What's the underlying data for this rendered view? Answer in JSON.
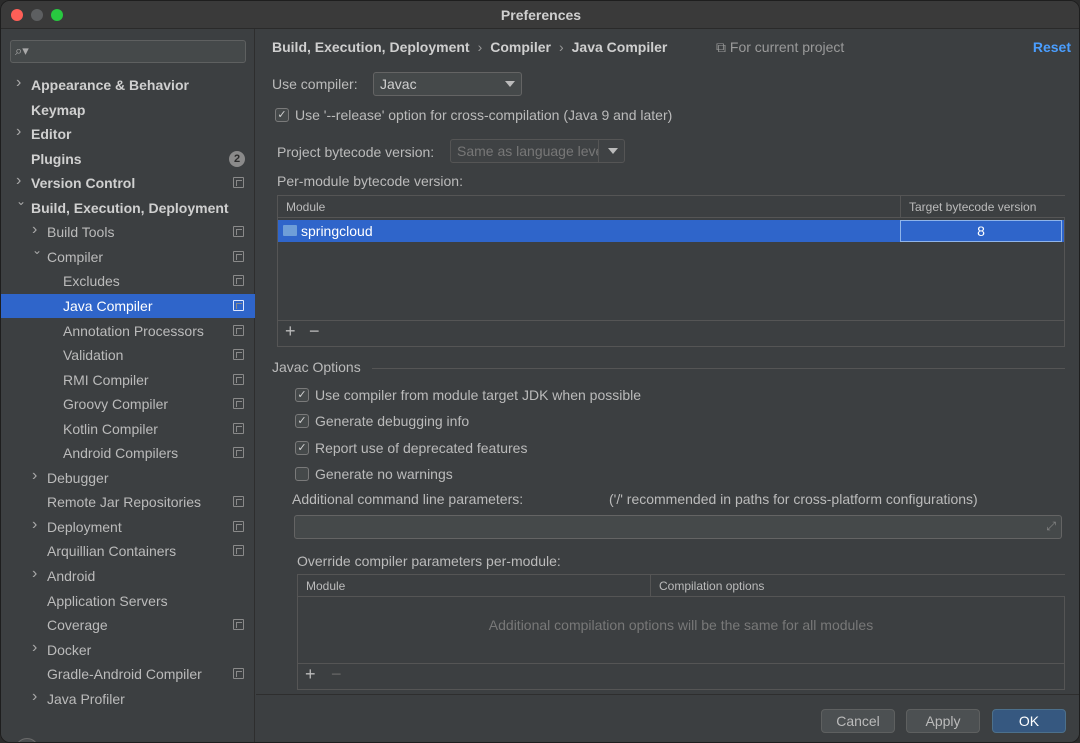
{
  "window": {
    "title": "Preferences"
  },
  "search": {
    "placeholder": ""
  },
  "sidebar": {
    "items": [
      {
        "label": "Appearance & Behavior",
        "level": 0,
        "arrow": "right",
        "bold": true
      },
      {
        "label": "Keymap",
        "level": 0,
        "arrow": "",
        "bold": true
      },
      {
        "label": "Editor",
        "level": 0,
        "arrow": "right",
        "bold": true
      },
      {
        "label": "Plugins",
        "level": 0,
        "arrow": "",
        "bold": true,
        "badge": "2"
      },
      {
        "label": "Version Control",
        "level": 0,
        "arrow": "right",
        "bold": true,
        "proj": true
      },
      {
        "label": "Build, Execution, Deployment",
        "level": 0,
        "arrow": "down",
        "bold": true
      },
      {
        "label": "Build Tools",
        "level": 1,
        "arrow": "right",
        "proj": true
      },
      {
        "label": "Compiler",
        "level": 1,
        "arrow": "down",
        "proj": true
      },
      {
        "label": "Excludes",
        "level": 2,
        "arrow": "",
        "proj": true
      },
      {
        "label": "Java Compiler",
        "level": 2,
        "arrow": "",
        "proj": true,
        "selected": true
      },
      {
        "label": "Annotation Processors",
        "level": 2,
        "arrow": "",
        "proj": true
      },
      {
        "label": "Validation",
        "level": 2,
        "arrow": "",
        "proj": true
      },
      {
        "label": "RMI Compiler",
        "level": 2,
        "arrow": "",
        "proj": true
      },
      {
        "label": "Groovy Compiler",
        "level": 2,
        "arrow": "",
        "proj": true
      },
      {
        "label": "Kotlin Compiler",
        "level": 2,
        "arrow": "",
        "proj": true
      },
      {
        "label": "Android Compilers",
        "level": 2,
        "arrow": "",
        "proj": true
      },
      {
        "label": "Debugger",
        "level": 1,
        "arrow": "right"
      },
      {
        "label": "Remote Jar Repositories",
        "level": 1,
        "arrow": "",
        "proj": true
      },
      {
        "label": "Deployment",
        "level": 1,
        "arrow": "right",
        "proj": true
      },
      {
        "label": "Arquillian Containers",
        "level": 1,
        "arrow": "",
        "proj": true
      },
      {
        "label": "Android",
        "level": 1,
        "arrow": "right"
      },
      {
        "label": "Application Servers",
        "level": 1,
        "arrow": ""
      },
      {
        "label": "Coverage",
        "level": 1,
        "arrow": "",
        "proj": true
      },
      {
        "label": "Docker",
        "level": 1,
        "arrow": "right"
      },
      {
        "label": "Gradle-Android Compiler",
        "level": 1,
        "arrow": "",
        "proj": true
      },
      {
        "label": "Java Profiler",
        "level": 1,
        "arrow": "right"
      }
    ]
  },
  "breadcrumb": {
    "parts": [
      "Build, Execution, Deployment",
      "Compiler",
      "Java Compiler"
    ],
    "scope": "For current project",
    "reset": "Reset"
  },
  "compiler": {
    "use_label": "Use compiler:",
    "use_value": "Javac",
    "release_label": "Use '--release' option for cross-compilation (Java 9 and later)",
    "release_checked": true,
    "bytecode_label": "Project bytecode version:",
    "bytecode_placeholder": "Same as language level",
    "per_module_label": "Per-module bytecode version:"
  },
  "module_table": {
    "headers": [
      "Module",
      "Target bytecode version"
    ],
    "rows": [
      {
        "module": "springcloud",
        "version": "8"
      }
    ]
  },
  "javac": {
    "section": "Javac Options",
    "options": [
      {
        "label": "Use compiler from module target JDK when possible",
        "checked": true
      },
      {
        "label": "Generate debugging info",
        "checked": true
      },
      {
        "label": "Report use of deprecated features",
        "checked": true
      },
      {
        "label": "Generate no warnings",
        "checked": false
      }
    ],
    "params_label": "Additional command line parameters:",
    "params_hint": "('/' recommended in paths for cross-platform configurations)",
    "params_value": "",
    "override_label": "Override compiler parameters per-module:"
  },
  "override_table": {
    "headers": [
      "Module",
      "Compilation options"
    ],
    "empty": "Additional compilation options will be the same for all modules"
  },
  "footer": {
    "cancel": "Cancel",
    "apply": "Apply",
    "ok": "OK",
    "help": "?"
  },
  "colors": {
    "accent": "#2f65ca",
    "link": "#4a9eff",
    "ok": "#365880"
  }
}
